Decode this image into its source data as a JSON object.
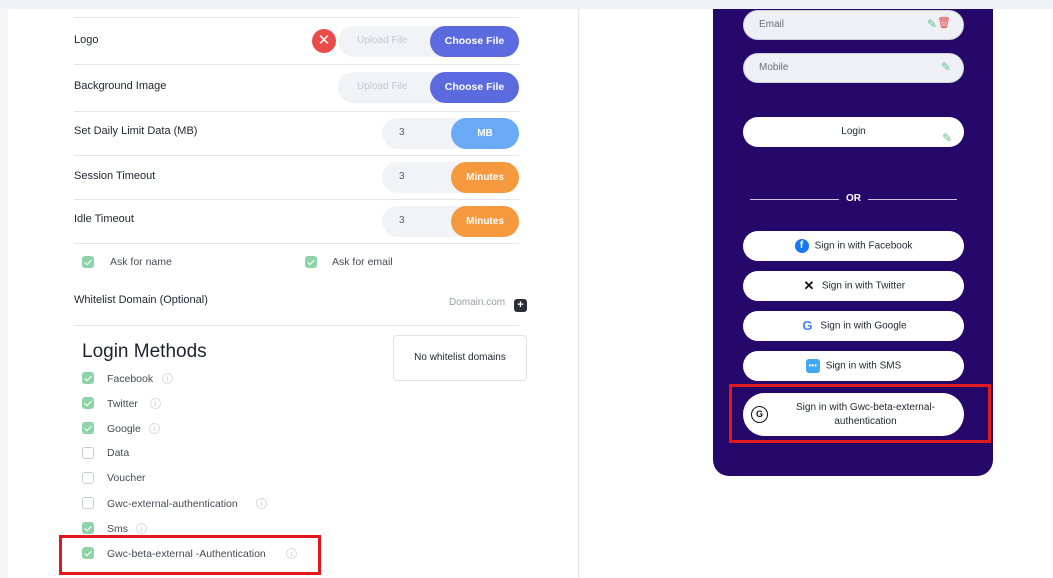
{
  "settings": {
    "logo": {
      "label": "Logo",
      "upload": "Upload File",
      "choose": "Choose File"
    },
    "background": {
      "label": "Background Image",
      "upload": "Upload File",
      "choose": "Choose File"
    },
    "daily_limit": {
      "label": "Set Daily Limit Data (MB)",
      "value": "3",
      "unit": "MB"
    },
    "session_timeout": {
      "label": "Session Timeout",
      "value": "3",
      "unit": "Minutes"
    },
    "idle_timeout": {
      "label": "Idle Timeout",
      "value": "3",
      "unit": "Minutes"
    },
    "ask_name": {
      "label": "Ask for name",
      "checked": true
    },
    "ask_email": {
      "label": "Ask for email",
      "checked": true
    },
    "whitelist": {
      "label": "Whitelist Domain (Optional)",
      "placeholder": "Domain.com",
      "empty": "No whitelist domains"
    }
  },
  "login_methods": {
    "title": "Login Methods",
    "items": [
      {
        "label": "Facebook",
        "checked": true,
        "info": true
      },
      {
        "label": "Twitter",
        "checked": true,
        "info": true
      },
      {
        "label": "Google",
        "checked": true,
        "info": true
      },
      {
        "label": "Data",
        "checked": false,
        "info": false
      },
      {
        "label": "Voucher",
        "checked": false,
        "info": false
      },
      {
        "label": "Gwc-external-authentication",
        "checked": false,
        "info": true
      },
      {
        "label": "Sms",
        "checked": true,
        "info": true
      },
      {
        "label": "Gwc-beta-external -Authentication",
        "checked": true,
        "info": true
      }
    ]
  },
  "preview": {
    "email": "Email",
    "mobile": "Mobile",
    "login": "Login",
    "or": "OR",
    "facebook": "Sign in with Facebook",
    "twitter": "Sign in with Twitter",
    "google": "Sign in with Google",
    "sms": "Sign in with SMS",
    "gwc_line1": "Sign in with Gwc-beta-external-",
    "gwc_line2": "authentication",
    "gwc_icon": "G",
    "phone_color": "#26086b"
  },
  "colors": {
    "accent": "#5c6ae0",
    "mb": "#6aaaf5",
    "minutes": "#f6983e",
    "check": "#8ed3a8",
    "highlight": "#e1191f"
  },
  "icons": [
    "close-icon",
    "facebook-icon",
    "x-twitter-icon",
    "google-icon",
    "sms-icon",
    "pencil-icon",
    "trash-icon",
    "info-icon",
    "plus-icon"
  ]
}
